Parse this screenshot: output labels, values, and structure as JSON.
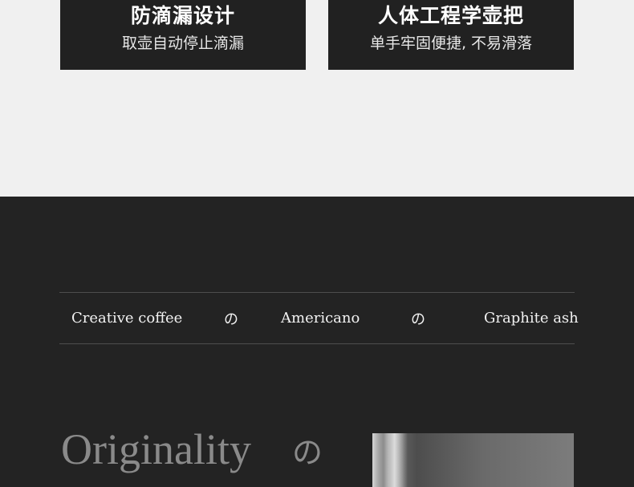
{
  "features": [
    {
      "title": "防滴漏设计",
      "subtitle": "取壶自动停止滴漏"
    },
    {
      "title": "人体工程学壶把",
      "subtitle": "单手牢固便捷, 不易滑落"
    }
  ],
  "strip": {
    "item1": "Creative coffee",
    "sep1": "の",
    "item2": "Americano",
    "sep2": "の",
    "item3": "Graphite ash"
  },
  "hero": {
    "word": "Originality",
    "particle": "の"
  },
  "colors": {
    "light_bg": "#f0f0f0",
    "dark_bg": "#232323",
    "card_bg": "#212121",
    "heading_gray": "#8a8a8a"
  }
}
